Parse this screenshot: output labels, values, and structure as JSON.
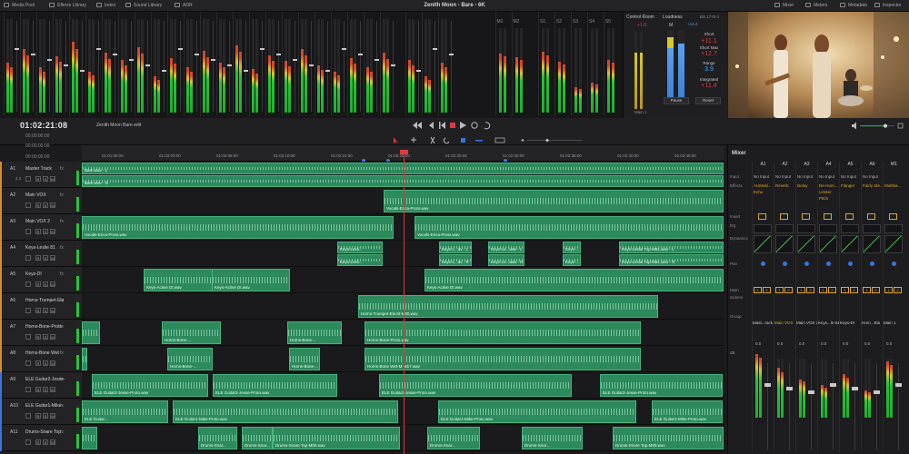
{
  "topbar": {
    "left_items": [
      "Media Pool",
      "Effects Library",
      "Index",
      "Sound Library",
      "ADR"
    ],
    "title": "Zenith Moon - Bare - 6K",
    "right_items": [
      "Mixer",
      "Meters",
      "Metadata",
      "Inspector"
    ]
  },
  "meters": {
    "bus_labels": [
      "M1",
      "M2"
    ],
    "sub_labels": [
      "S1",
      "S2",
      "S3",
      "S4",
      "S5"
    ],
    "control_room": "Control Room",
    "control_room_value": "+1.8",
    "loudness": "Loudness",
    "loudness_std": "BS.1770-1",
    "loudness_m_value": "+13.4",
    "short_label": "Short",
    "short_value": "+11.1",
    "short_max_label": "Short Max",
    "short_max_value": "+12.7",
    "range_label": "Range",
    "range_value": "3.9",
    "integrated_label": "Integrated",
    "integrated_value": "+11.4",
    "pause_label": "Pause",
    "reset_label": "Reset",
    "main_label": "Main 1",
    "m_label": "M",
    "tp_label": "TP"
  },
  "transport": {
    "timecode": "01:02:21:08",
    "timeline_name": "Zenith Moon Bare edit",
    "sub_timecodes": [
      "00:00:00:00",
      "00:00:00:00",
      "00:00:00:00"
    ]
  },
  "ruler": {
    "ticks": [
      "01:01:55:00",
      "01:02:00:00",
      "01:02:05:00",
      "01:02:10:00",
      "01:02:15:00",
      "01:02:20:00",
      "01:02:25:00",
      "01:02:30:00",
      "01:02:35:00",
      "01:02:40:00",
      "01:02:45:00"
    ]
  },
  "tracks": [
    {
      "id": "A1",
      "name": "Master Track",
      "color": "#d98a2b",
      "level": "2.2",
      "clips": [
        {
          "label": "Bare.wav - L",
          "lane_top": true
        },
        {
          "label": "Bare.wav - R",
          "lane_top": false
        }
      ]
    },
    {
      "id": "A2",
      "name": "Main VOX",
      "color": "#d98a2b",
      "clips": [
        {
          "label": "Vocals-Erica-Proto.wav"
        }
      ]
    },
    {
      "id": "A3",
      "name": "Main VOX 2",
      "color": "#d98a2b",
      "clips": [
        {
          "label": "Vocals-Erica-Proto.wav"
        },
        {
          "label": "Vocals-Erica-Proto.wav"
        }
      ]
    },
    {
      "id": "A4",
      "name": "Keys-Leslie 81",
      "color": "#d98a2b",
      "clips": [
        {
          "label": "Keys-Lesli..."
        },
        {
          "label": "Keys-Lesli..."
        },
        {
          "label": "Keys-L...av - L"
        },
        {
          "label": "Keys-L...av - R"
        },
        {
          "label": "Keys-Le...wav - L"
        },
        {
          "label": "Keys-Le...wav - R"
        },
        {
          "label": "Keys-..."
        },
        {
          "label": "Keys-..."
        },
        {
          "label": "Keys-Leslie Top-M81.wav - L"
        },
        {
          "label": "Keys-Leslie Top-M81.wav - R"
        }
      ]
    },
    {
      "id": "A5",
      "name": "Keys-DI",
      "color": "#d98a2b",
      "clips": [
        {
          "label": "Keys-Active DI.wav"
        },
        {
          "label": "Keys-Active DI.wav"
        },
        {
          "label": "Keys-Active DI.wav"
        }
      ]
    },
    {
      "id": "A6",
      "name": "Horns-Trumpet-Ela",
      "color": "#d98a2b",
      "clips": [
        {
          "label": "Horns-Trumpet-Ela M-M80.wav"
        }
      ]
    },
    {
      "id": "A7",
      "name": "Horns-Bone-Proto",
      "color": "#d98a2b",
      "clips": [
        {
          "label": "Horns-Bone-..."
        },
        {
          "label": "Horns-Bone-..."
        },
        {
          "label": "Horns-Bone-Proto.wav"
        }
      ]
    },
    {
      "id": "A8",
      "name": "Horns-Bone Wet",
      "color": "#d98a2b",
      "clips": [
        {
          "label": "Horns-Bone-..."
        },
        {
          "label": "Horns-Bone-..."
        },
        {
          "label": "Horns-Bone Wet-M-M17.wav"
        }
      ]
    },
    {
      "id": "A9",
      "name": "ELE Guitar2-Jesse-",
      "color": "#3a74d9",
      "clips": [
        {
          "label": "ELE Guitar2-Jesse-Proto.wav"
        },
        {
          "label": "ELE Guitar2-Jesse-Proto.wav"
        },
        {
          "label": "ELE Guitar2-Jesse-Proto.wav"
        },
        {
          "label": "ELE Guitar2-Jesse-Proto.wav"
        }
      ]
    },
    {
      "id": "A10",
      "name": "ELE Guitar1-Mike-",
      "color": "#3a74d9",
      "clips": [
        {
          "label": "ELE Guitar..."
        },
        {
          "label": "ELE Guitar1-Mike-Proto.wav"
        },
        {
          "label": "ELE Guitar1-Mike-Proto.wav"
        },
        {
          "label": "ELE Guitar1-Mike-Proto.wav"
        }
      ]
    },
    {
      "id": "A11",
      "name": "Drums-Snare Top",
      "color": "#3a74d9",
      "clips": [
        {
          "label": "Drums-Snar..."
        },
        {
          "label": "Drums-Snar..."
        },
        {
          "label": "Drums-Snare Top-M80.wav"
        },
        {
          "label": "Drums-Snar..."
        },
        {
          "label": "Drums-Snar..."
        },
        {
          "label": "Drums-Snare Top-M80.wav"
        }
      ]
    }
  ],
  "mixer": {
    "title": "Mixer",
    "row_labels": [
      "Input",
      "Effects",
      "Insert",
      "EQ",
      "Dynamics",
      "Pan",
      "Main",
      "Subme",
      "Group",
      "dB"
    ],
    "channels": [
      {
        "head": "A1",
        "input": "No Input",
        "effects": [
          "AUMulti...",
          "Echo"
        ],
        "name": "Mast...rack",
        "level": "0.0"
      },
      {
        "head": "A2",
        "input": "No Input",
        "effects": [
          "Reverb"
        ],
        "name": "Main VOX",
        "level": "0.0"
      },
      {
        "head": "A3",
        "input": "No Input",
        "effects": [
          "Delay"
        ],
        "name": "Main VOX 2",
        "level": "0.0"
      },
      {
        "head": "A4",
        "input": "No Input",
        "effects": [
          "De-Hum...",
          "Limiter",
          "Pitch"
        ],
        "name": "Keys...le 81",
        "level": "0.0"
      },
      {
        "head": "A5",
        "input": "No Input",
        "effects": [
          "Flanger"
        ],
        "name": "Keys-DI",
        "level": "0.0"
      },
      {
        "head": "A6",
        "input": "No Input",
        "effects": [
          "Fairly Ste..."
        ],
        "name": "Horn...Ela",
        "level": "0.0"
      },
      {
        "head": "M1",
        "input": "",
        "effects": [
          "Multiba..."
        ],
        "name": "Main 1",
        "level": "0.0"
      }
    ]
  }
}
